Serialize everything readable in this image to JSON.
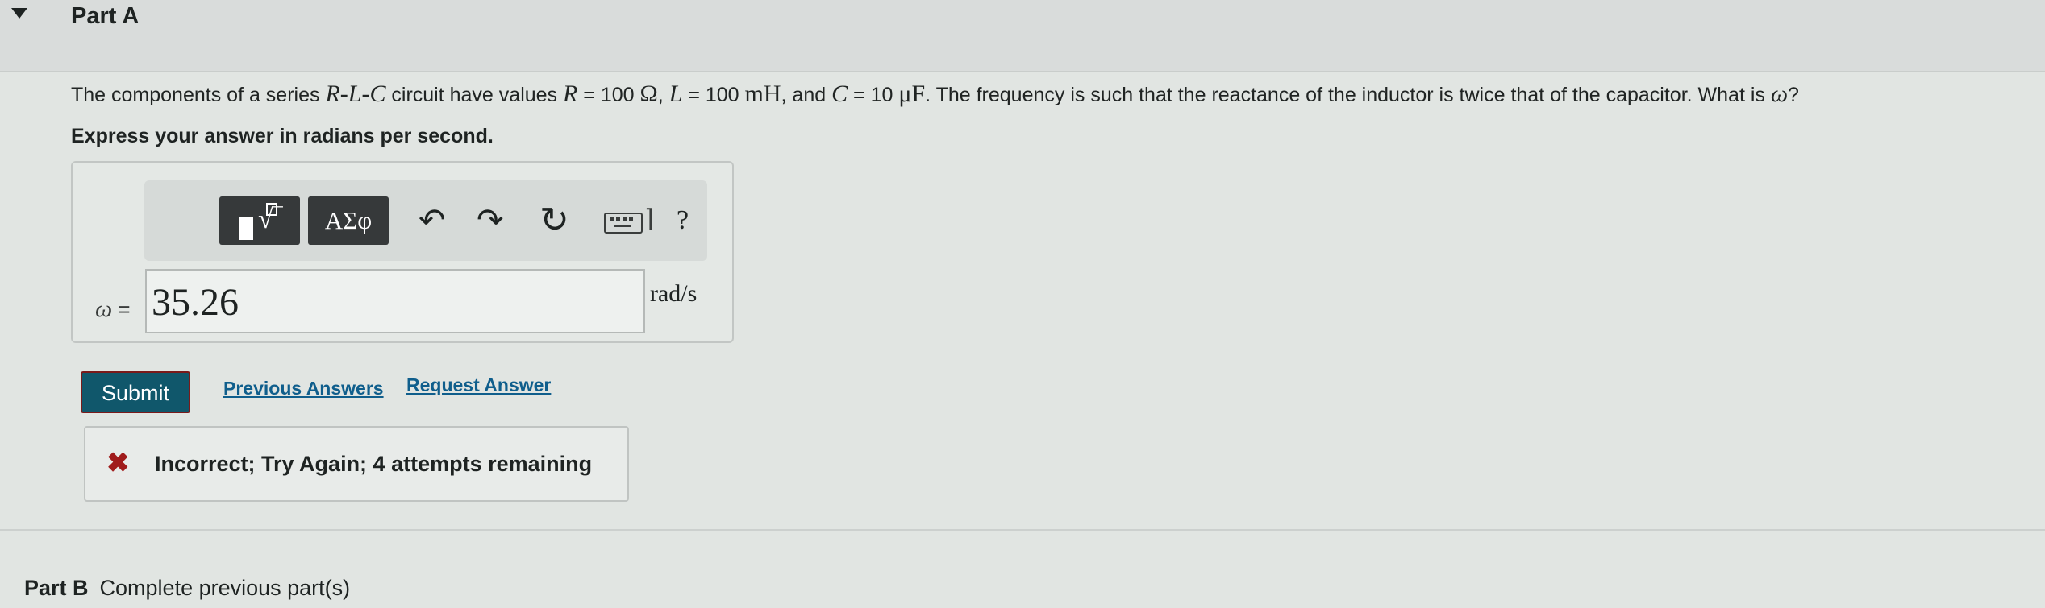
{
  "part_a": {
    "title": "Part A"
  },
  "question": {
    "t1": "The components of a series ",
    "m1": "R-L-C",
    "t2": " circuit have values ",
    "m2": "R",
    "t3": " = 100 ",
    "u1": "Ω",
    "t4": ", ",
    "m3": "L",
    "t5": " = 100 ",
    "u2": "mH",
    "t6": ", and ",
    "m4": "C",
    "t7": " = 10 ",
    "u3": "μF",
    "t8": ". The frequency is such that the reactance of the inductor is twice that of the capacitor. What is ",
    "m5": "ω",
    "t9": "?"
  },
  "instruction": "Express your answer in radians per second.",
  "toolbar": {
    "greek_label": "ΑΣφ",
    "undo_glyph": "↶",
    "redo_glyph": "↷",
    "reset_glyph": "↻",
    "kbd_caret": "⌉",
    "help_label": "?"
  },
  "answer": {
    "var": "ω",
    "equals": " =",
    "value": "35.26",
    "units": "rad/s"
  },
  "actions": {
    "submit": "Submit",
    "previous_answers": "Previous Answers",
    "request_answer": "Request Answer"
  },
  "feedback": {
    "icon": "✖",
    "message": "Incorrect; Try Again; 4 attempts remaining"
  },
  "part_b": {
    "title": "Part B",
    "status": "Complete previous part(s)"
  },
  "colors": {
    "submit_bg": "#10576b",
    "link": "#0f5e8c",
    "error": "#a01c1c"
  }
}
